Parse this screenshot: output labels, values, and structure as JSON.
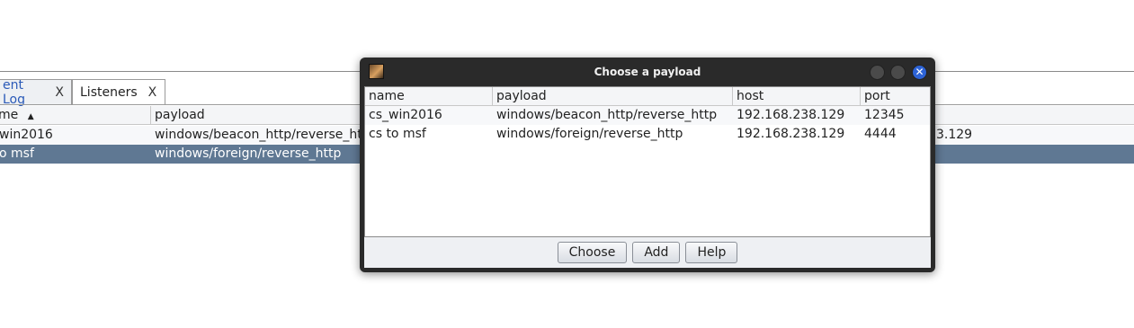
{
  "background": {
    "tabs": [
      {
        "label": "ent Log",
        "close": "X"
      },
      {
        "label": "Listeners",
        "close": "X"
      }
    ],
    "columns": [
      "me",
      "payload"
    ],
    "rows": [
      {
        "name": "win2016",
        "payload": "windows/beacon_http/reverse_ht",
        "right": "3.129"
      },
      {
        "name": "o msf",
        "payload": "windows/foreign/reverse_http",
        "right": ""
      }
    ],
    "selected_row": 1
  },
  "dialog": {
    "title": "Choose a payload",
    "columns": [
      "name",
      "payload",
      "host",
      "port"
    ],
    "rows": [
      {
        "name": "cs_win2016",
        "payload": "windows/beacon_http/reverse_http",
        "host": "192.168.238.129",
        "port": "12345"
      },
      {
        "name": "cs to msf",
        "payload": "windows/foreign/reverse_http",
        "host": "192.168.238.129",
        "port": "4444"
      }
    ],
    "buttons": {
      "choose": "Choose",
      "add": "Add",
      "help": "Help"
    },
    "close_glyph": "✕"
  },
  "icons": [
    "app-icon",
    "minimize-icon",
    "maximize-icon",
    "close-icon",
    "sort-ascending-icon"
  ],
  "colors": {
    "selection": "#5f7893",
    "link_tab": "#2b5ab8",
    "close_button": "#2d63d6",
    "titlebar": "#2a2a2a"
  }
}
